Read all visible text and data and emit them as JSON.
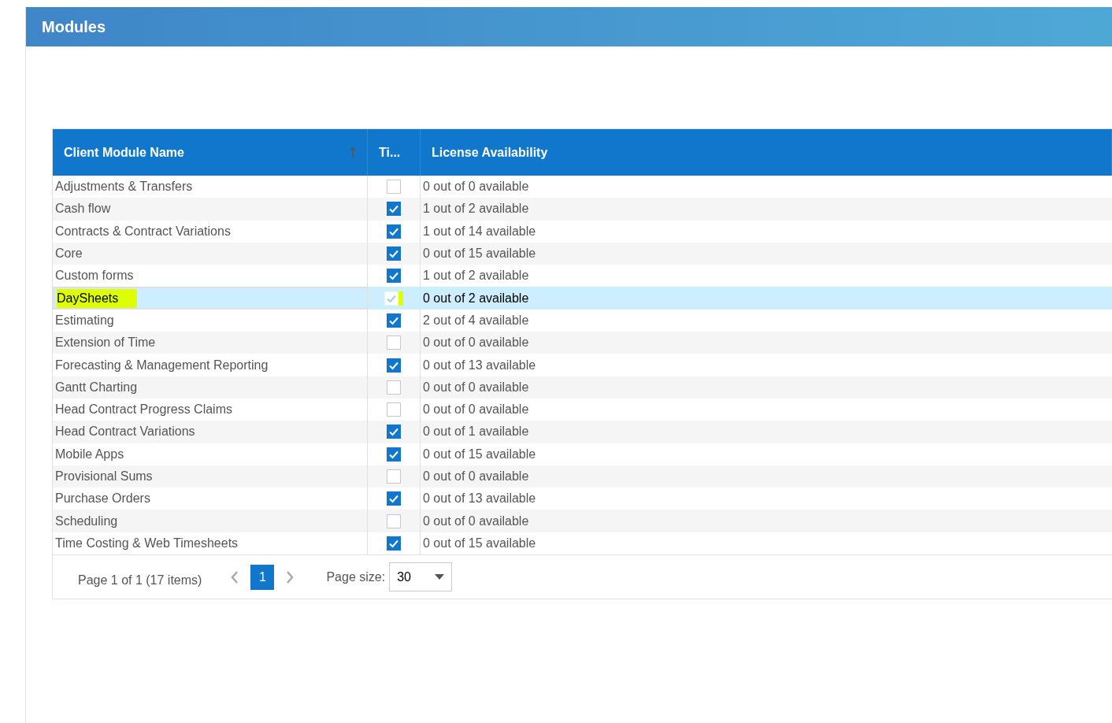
{
  "panel": {
    "title": "Modules"
  },
  "table": {
    "columns": [
      {
        "label": "Client Module Name",
        "sorted": true
      },
      {
        "label": "Ti...",
        "sorted": false
      },
      {
        "label": "License Availability",
        "sorted": false
      }
    ],
    "rows": [
      {
        "name": "Adjustments & Transfers",
        "checked": false,
        "availability": "0 out of 0 available",
        "selected": false,
        "highlighted": false
      },
      {
        "name": "Cash flow",
        "checked": true,
        "availability": "1 out of 2 available",
        "selected": false,
        "highlighted": false
      },
      {
        "name": "Contracts & Contract Variations",
        "checked": true,
        "availability": "1 out of 14 available",
        "selected": false,
        "highlighted": false
      },
      {
        "name": "Core",
        "checked": true,
        "availability": "0 out of 15 available",
        "selected": false,
        "highlighted": false
      },
      {
        "name": "Custom forms",
        "checked": true,
        "availability": "1 out of 2 available",
        "selected": false,
        "highlighted": false
      },
      {
        "name": "DaySheets",
        "checked": true,
        "availability": "0 out of 2 available",
        "selected": true,
        "highlighted": true
      },
      {
        "name": "Estimating",
        "checked": true,
        "availability": "2 out of 4 available",
        "selected": false,
        "highlighted": false
      },
      {
        "name": "Extension of Time",
        "checked": false,
        "availability": "0 out of 0 available",
        "selected": false,
        "highlighted": false
      },
      {
        "name": "Forecasting & Management Reporting",
        "checked": true,
        "availability": "0 out of 13 available",
        "selected": false,
        "highlighted": false
      },
      {
        "name": "Gantt Charting",
        "checked": false,
        "availability": "0 out of 0 available",
        "selected": false,
        "highlighted": false
      },
      {
        "name": "Head Contract Progress Claims",
        "checked": false,
        "availability": "0 out of 0 available",
        "selected": false,
        "highlighted": false
      },
      {
        "name": "Head Contract Variations",
        "checked": true,
        "availability": "0 out of 1 available",
        "selected": false,
        "highlighted": false
      },
      {
        "name": "Mobile Apps",
        "checked": true,
        "availability": "0 out of 15 available",
        "selected": false,
        "highlighted": false
      },
      {
        "name": "Provisional Sums",
        "checked": false,
        "availability": "0 out of 0 available",
        "selected": false,
        "highlighted": false
      },
      {
        "name": "Purchase Orders",
        "checked": true,
        "availability": "0 out of 13 available",
        "selected": false,
        "highlighted": false
      },
      {
        "name": "Scheduling",
        "checked": false,
        "availability": "0 out of 0 available",
        "selected": false,
        "highlighted": false
      },
      {
        "name": "Time Costing & Web Timesheets",
        "checked": true,
        "availability": "0 out of 15 available",
        "selected": false,
        "highlighted": false
      }
    ]
  },
  "pager": {
    "summary": "Page 1 of 1 (17 items)",
    "pages": [
      {
        "label": "1",
        "selected": true
      }
    ],
    "page_size_label": "Page size:",
    "page_size": "30"
  }
}
